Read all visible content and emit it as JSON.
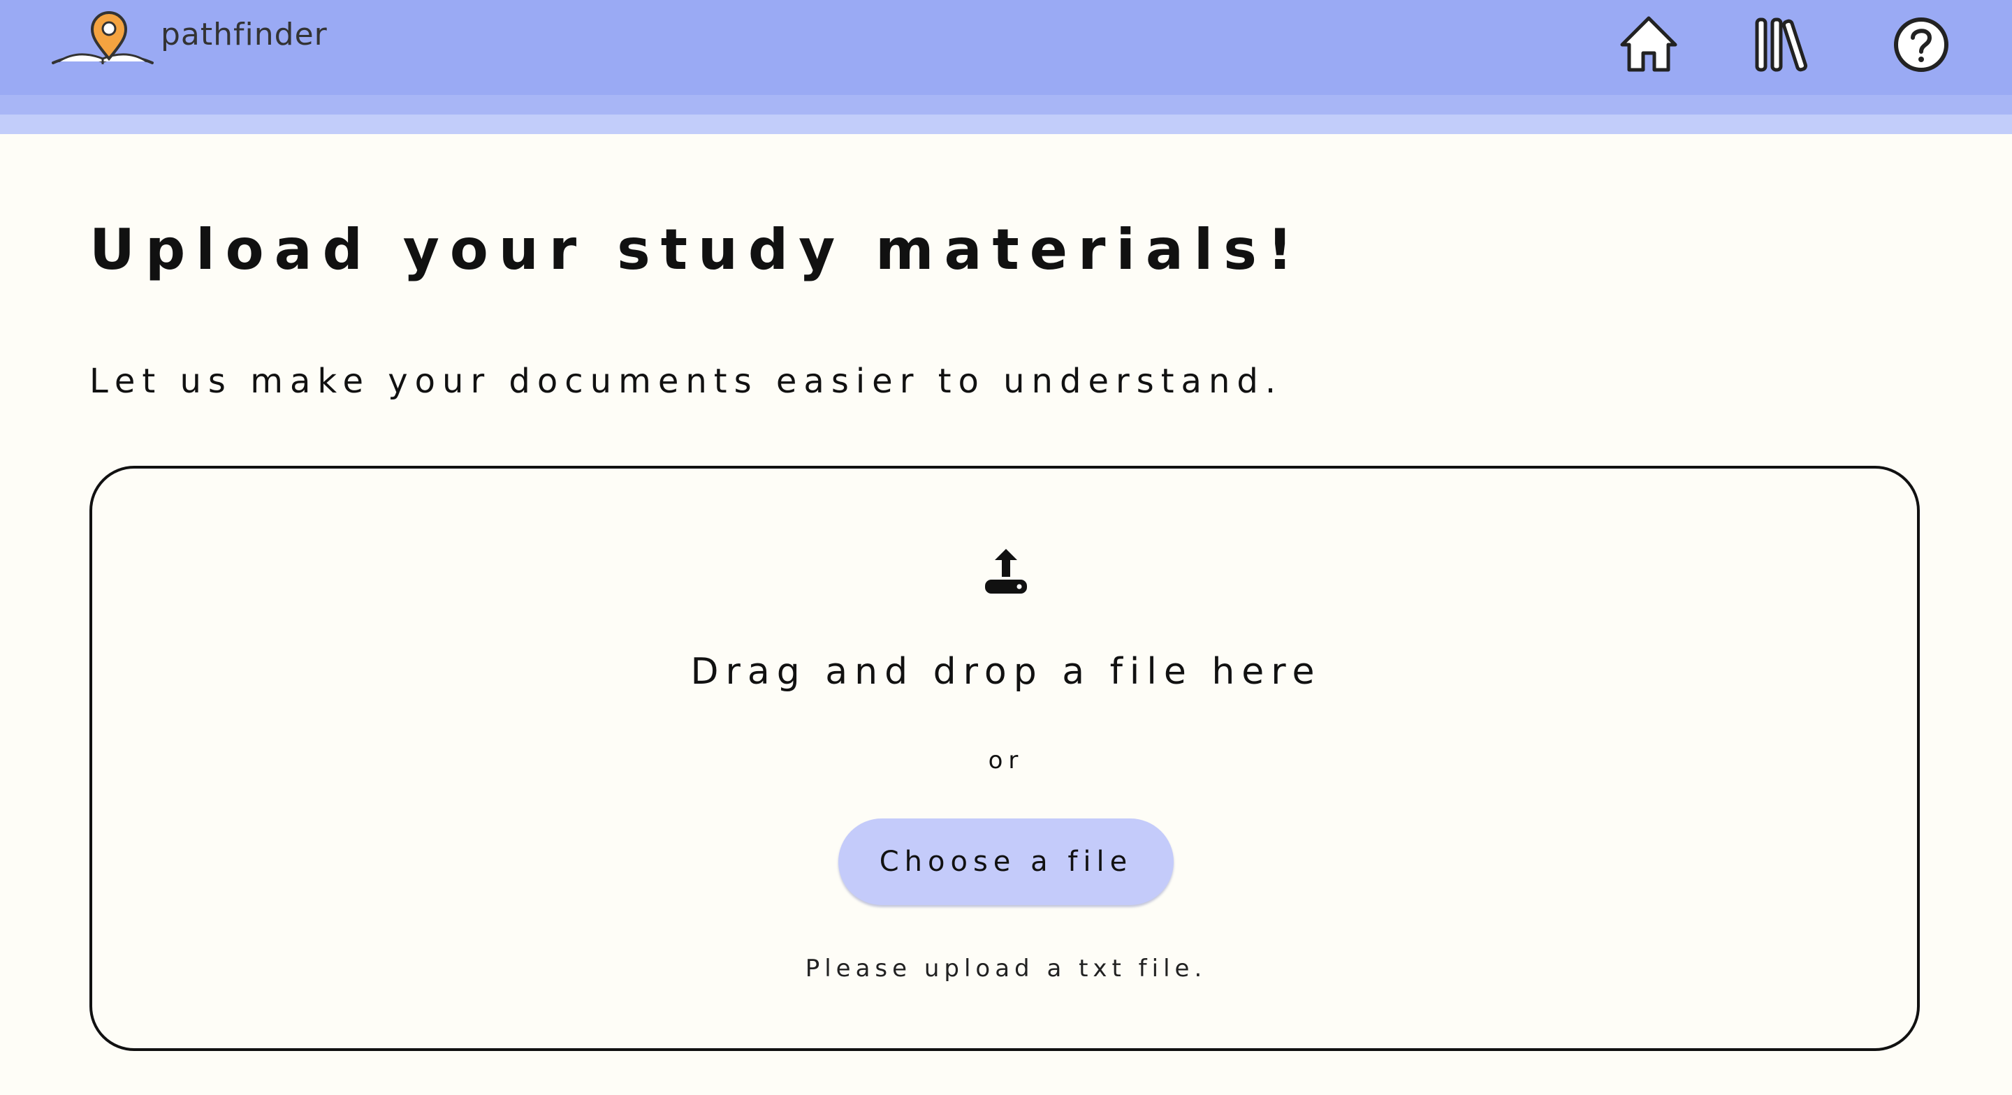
{
  "header": {
    "brand": "pathfinder",
    "logo_icon": "map-pin-book-icon",
    "nav": [
      {
        "label": "Home",
        "icon": "home-icon"
      },
      {
        "label": "Library",
        "icon": "library-icon"
      },
      {
        "label": "Help",
        "icon": "help-icon"
      }
    ],
    "colors": {
      "bar": "#9aaaf4",
      "band1": "#a8b6f6",
      "band2": "#c2cdfa",
      "pin": "#f4a340"
    }
  },
  "main": {
    "title": "Upload your study materials!",
    "subtitle": "Let us make your documents easier to understand."
  },
  "dropzone": {
    "icon": "upload-icon",
    "drop_label": "Drag and drop a file here",
    "or_label": "or",
    "choose_button": "Choose a file",
    "hint": "Please upload a txt file.",
    "button_color": "#c4cbfa"
  }
}
